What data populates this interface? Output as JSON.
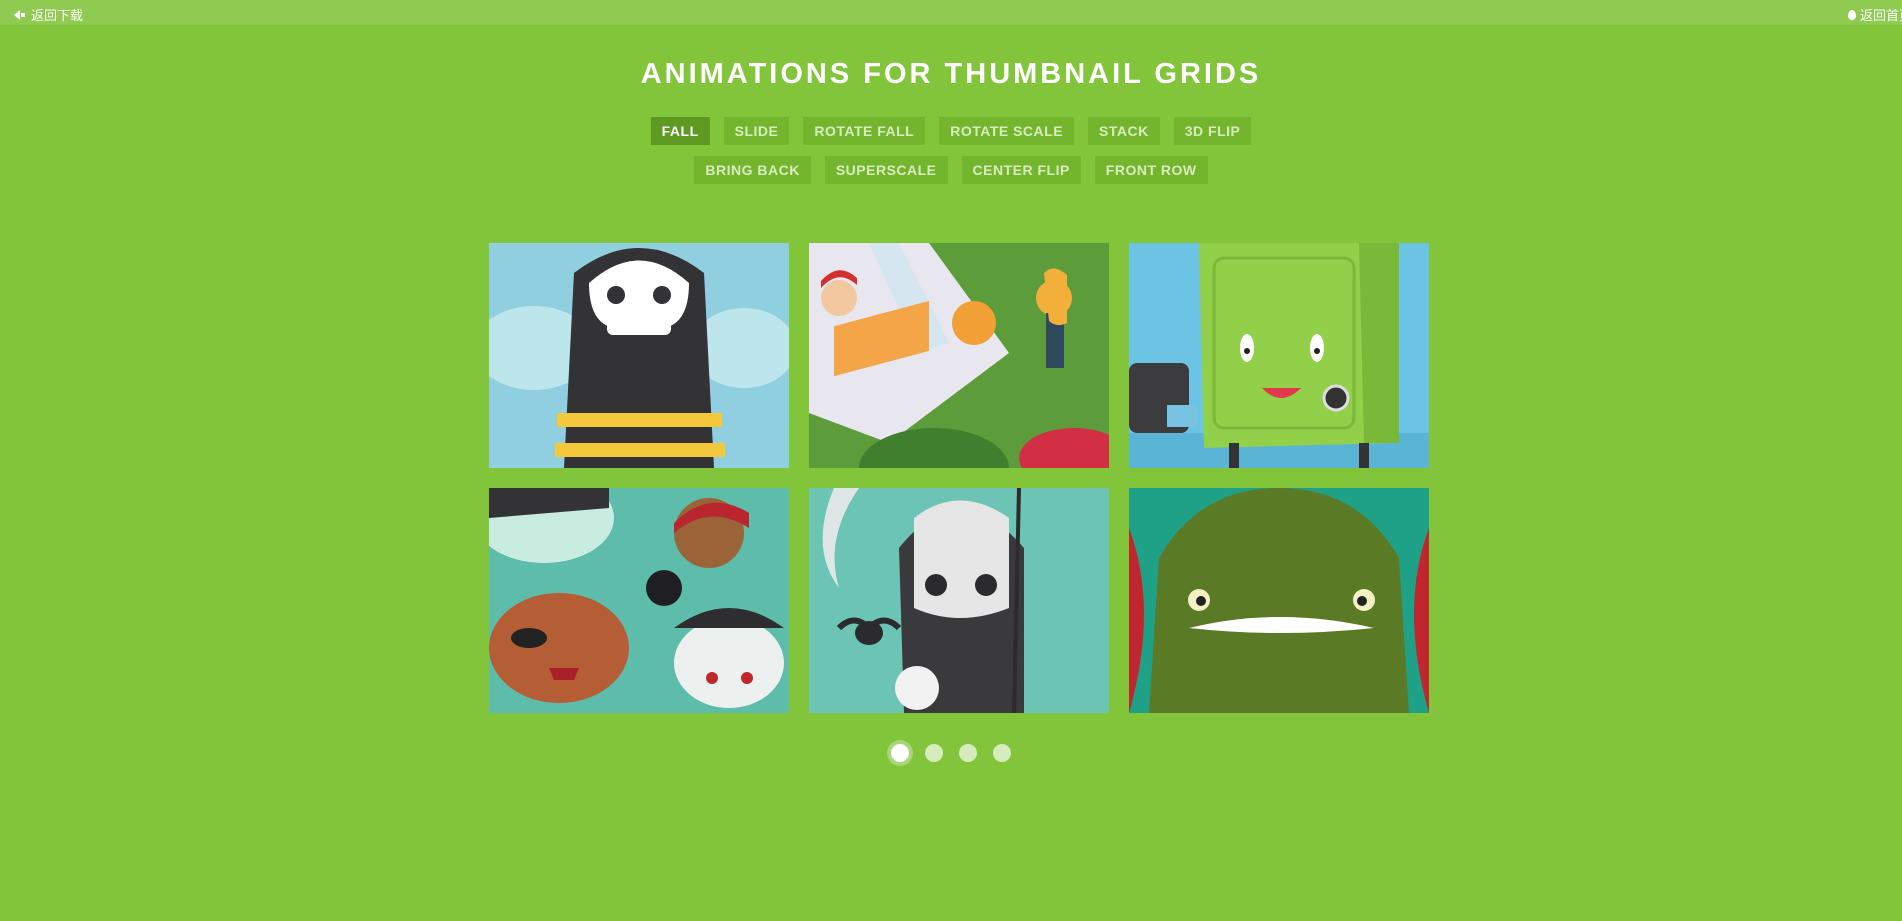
{
  "topbar": {
    "back_download": "返回下载",
    "back_home": "返回首页"
  },
  "title": "ANIMATIONS FOR THUMBNAIL GRIDS",
  "tabs_row1": [
    {
      "label": "Fall",
      "active": true
    },
    {
      "label": "Slide"
    },
    {
      "label": "Rotate Fall"
    },
    {
      "label": "Rotate Scale"
    },
    {
      "label": "Stack"
    },
    {
      "label": "3D Flip"
    }
  ],
  "tabs_row2": [
    {
      "label": "Bring Back"
    },
    {
      "label": "Superscale"
    },
    {
      "label": "Center Flip"
    },
    {
      "label": "Front Row"
    }
  ],
  "thumbnails": [
    {
      "name": "bee-skull-thumbnail"
    },
    {
      "name": "office-scene-thumbnail"
    },
    {
      "name": "green-safe-thumbnail"
    },
    {
      "name": "pirates-thumbnail"
    },
    {
      "name": "reaper-thumbnail"
    },
    {
      "name": "green-monster-thumbnail"
    }
  ],
  "pagination": {
    "pages": 4,
    "current": 1
  },
  "colors": {
    "background": "#82c43a",
    "tab_active": "#5e9a22",
    "tab": "#74b52e"
  }
}
